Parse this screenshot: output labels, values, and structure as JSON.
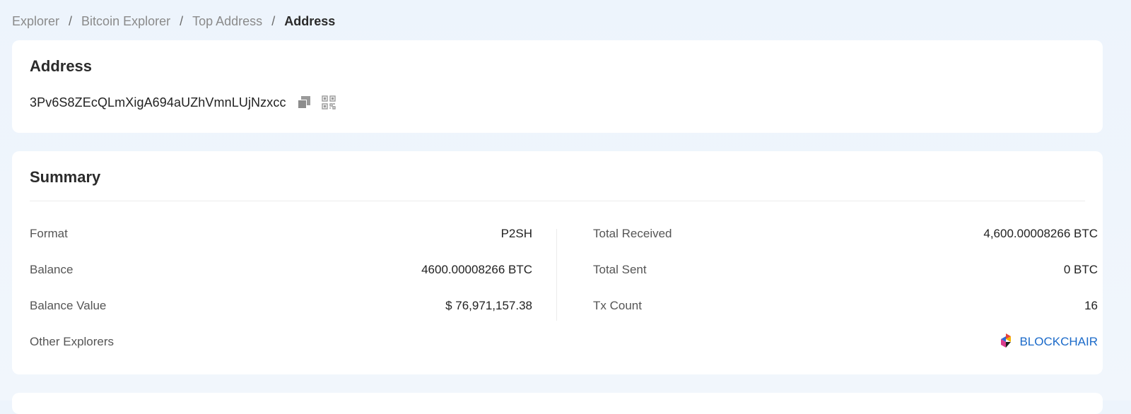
{
  "breadcrumb": {
    "items": [
      "Explorer",
      "Bitcoin Explorer",
      "Top Address"
    ],
    "current": "Address",
    "separator": "/"
  },
  "address_card": {
    "title": "Address",
    "address": "3Pv6S8ZEcQLmXigA694aUZhVmnLUjNzxcc",
    "icons": [
      "copy-icon",
      "qr-code-icon"
    ]
  },
  "summary": {
    "title": "Summary",
    "left": [
      {
        "label": "Format",
        "value": "P2SH"
      },
      {
        "label": "Balance",
        "value": "4600.00008266 BTC"
      },
      {
        "label": "Balance Value",
        "value": "$ 76,971,157.38"
      }
    ],
    "right": [
      {
        "label": "Total Received",
        "value": "4,600.00008266 BTC"
      },
      {
        "label": "Total Sent",
        "value": "0 BTC"
      },
      {
        "label": "Tx Count",
        "value": "16"
      }
    ],
    "other_explorers": {
      "label": "Other Explorers",
      "link_text": "BLOCKCHAIR",
      "icon": "blockchair-logo-icon"
    }
  },
  "colors": {
    "background": "#edf4fc",
    "card": "#ffffff",
    "link": "#1b6ac9",
    "muted": "#8a8a8a"
  }
}
